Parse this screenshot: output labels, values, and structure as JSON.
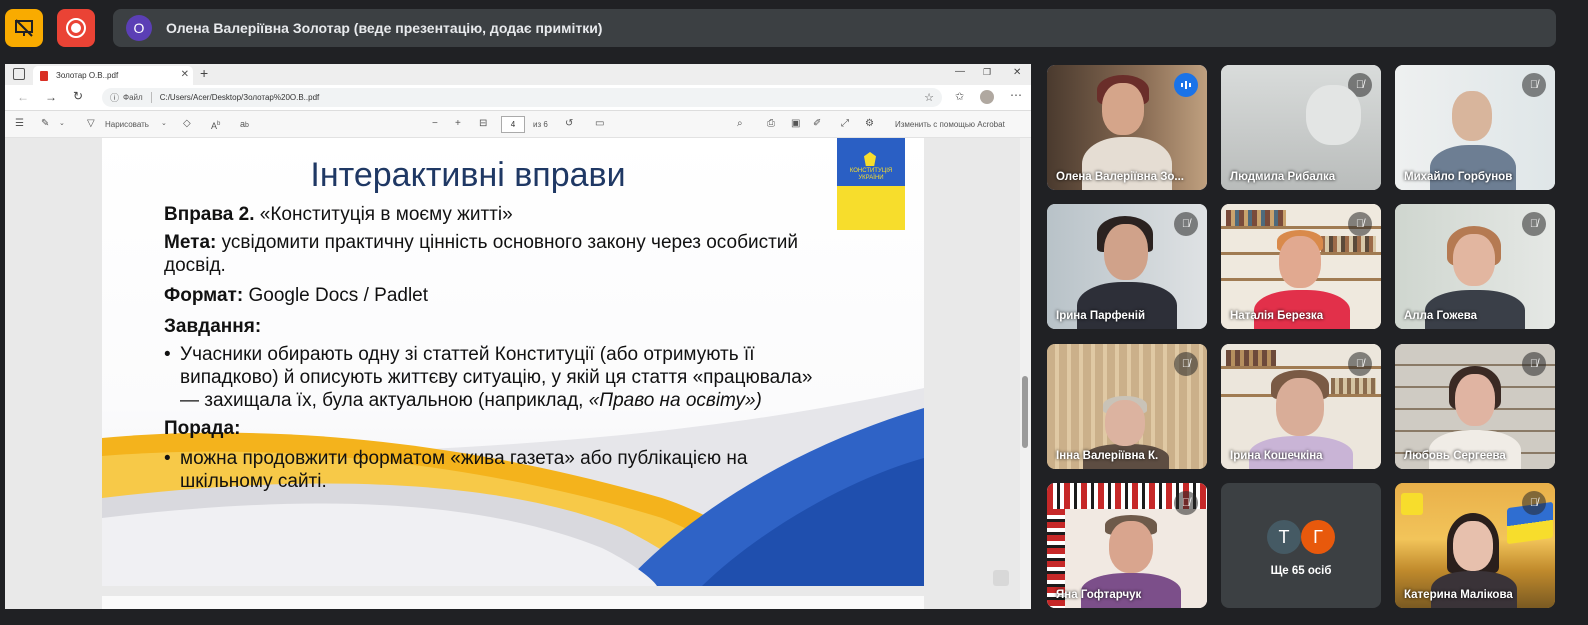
{
  "meeting": {
    "presenter_initial": "О",
    "presenter_banner": "Олена Валеріївна Золотар (веде презентацію, додає примітки)",
    "present_icon": "presentation-off-icon",
    "record_icon": "record-icon"
  },
  "browser": {
    "tab_title": "Золотар О.В..pdf",
    "address_label": "Файл",
    "address": "C:/Users/Acer/Desktop/Золотар%20О.В..pdf"
  },
  "pdf_toolbar": {
    "draw_label": "Нарисовать",
    "page_current": "4",
    "page_total": "из 6",
    "acrobat_label": "Изменить с помощью Acrobat"
  },
  "slide": {
    "title": "Інтерактивні вправи",
    "exercise_label": "Вправа 2.",
    "exercise_name": "«Конституція в моєму житті»",
    "goal_label": "Мета:",
    "goal_text": "усвідомити практичну цінність основного закону через особистий",
    "goal_text2": "досвід.",
    "format_label": "Формат:",
    "format_text": "Google Docs / Padlet",
    "task_label": "Завдання:",
    "task_line1": "Учасники обирають одну зі статтей Конституції (або отримують її",
    "task_line2": "випадково) й описують життєву ситуацію, у якій ця стаття «працювала»",
    "task_line3": "— захищала їх, була актуальною (наприклад,",
    "task_line3_italic": "«Право на освіту»)",
    "tip_label": "Порада:",
    "tip_line1": "можна продовжити форматом «жива газета» або публікацією на",
    "tip_line2": "шкільному сайті.",
    "book_text": "КОНСТИТУЦІЯ УКРАЇНИ"
  },
  "participants": [
    {
      "name": "Олена Валеріївна Зо...",
      "state": "speaking"
    },
    {
      "name": "Людмила Рибалка",
      "state": "muted"
    },
    {
      "name": "Михайло Горбунов",
      "state": "muted"
    },
    {
      "name": "Ірина Парфеній",
      "state": "muted"
    },
    {
      "name": "Наталія Березка",
      "state": "muted"
    },
    {
      "name": "Алла Гожева",
      "state": "muted"
    },
    {
      "name": "Інна Валеріївна К.",
      "state": "muted"
    },
    {
      "name": "Ірина Кошечкіна",
      "state": "muted"
    },
    {
      "name": "Любовь Сергеева",
      "state": "muted"
    },
    {
      "name": "Яна Гофтарчук",
      "state": "muted"
    },
    {
      "name": "Катерина Малікова",
      "state": "muted"
    }
  ],
  "more_people": {
    "initials": [
      "Т",
      "Г"
    ],
    "colors": [
      "#455a64",
      "#e8590c"
    ],
    "label": "Ще 65 осіб"
  }
}
